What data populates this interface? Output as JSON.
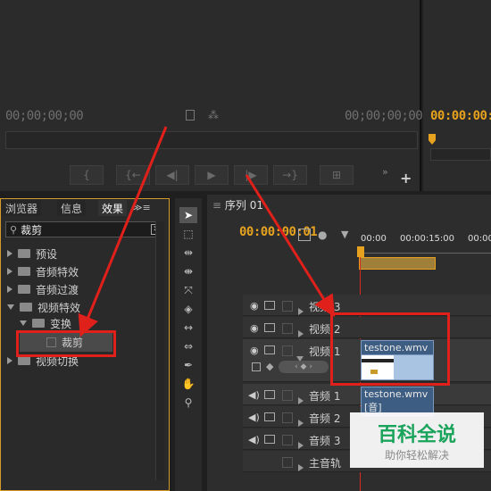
{
  "source_monitor": {
    "timecode_left": "00;00;00;00",
    "timecode_right": "00;00;00;00",
    "controls": [
      "{",
      "{←",
      "◀|",
      "▶",
      "|▶",
      "→}",
      "⊞"
    ]
  },
  "program_monitor": {
    "timecode": "00:00:00:00"
  },
  "panel_tabs": [
    "浏览器",
    "信息",
    "效果"
  ],
  "effects": {
    "search_value": "裁剪",
    "tree": [
      {
        "label": "预设",
        "state": "collapsed"
      },
      {
        "label": "音频特效",
        "state": "collapsed"
      },
      {
        "label": "音频过渡",
        "state": "collapsed"
      },
      {
        "label": "视频特效",
        "state": "expanded"
      },
      {
        "label": "变换",
        "state": "expanded"
      },
      {
        "label": "裁剪",
        "state": "selected"
      },
      {
        "label": "视频切换",
        "state": "collapsed"
      }
    ]
  },
  "sequence": {
    "tab": "序列 01",
    "timecode": "00:00:00:01",
    "ruler": [
      "00:00",
      "00:00:15:00",
      "00:00"
    ]
  },
  "tracks": {
    "video": [
      "视频 3",
      "视频 2",
      "视频 1"
    ],
    "audio": [
      "音频 1",
      "音频 2",
      "音频 3"
    ],
    "master": "主音轨"
  },
  "clips": {
    "video": "testone.wmv [视]",
    "audio": "testone.wmv [音]"
  },
  "watermark": {
    "title": "百科全说",
    "subtitle": "助你轻松解决"
  },
  "colors": {
    "accent": "#e6a21e",
    "annotation": "#e0201a",
    "clip": "#3d5d82"
  }
}
